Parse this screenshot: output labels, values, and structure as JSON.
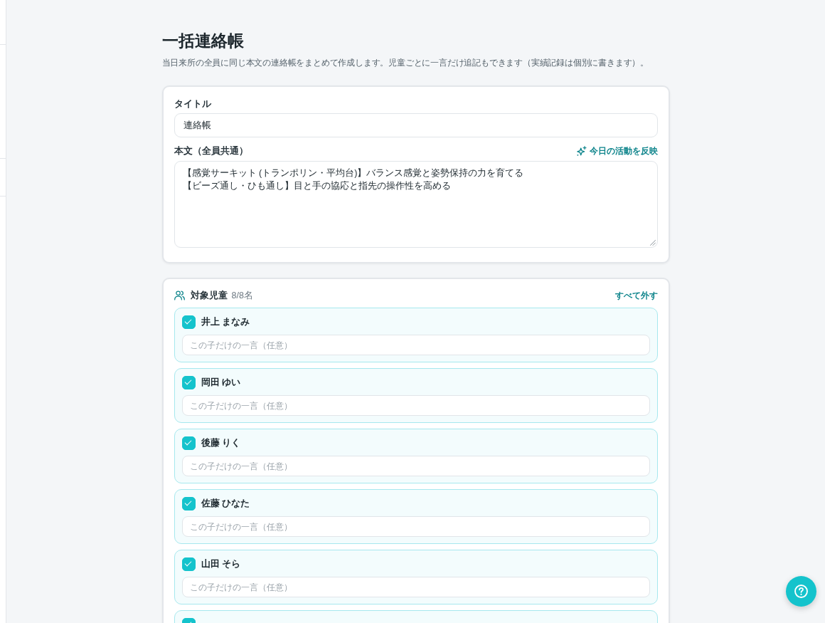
{
  "page": {
    "title": "一括連絡帳",
    "description": "当日来所の全員に同じ本文の連絡帳をまとめて作成します。児童ごとに一言だけ追記もできます（実績記録は個別に書きます）。"
  },
  "form": {
    "title_label": "タイトル",
    "title_value": "連絡帳",
    "body_label": "本文（全員共通）",
    "reflect_button": "今日の活動を反映",
    "body_lines": [
      "【感覚サーキット (トランポリン・平均台)】バランス感覚と姿勢保持の力を育てる",
      "【ビーズ通し・ひも通し】目と手の協応と指先の操作性を高める"
    ]
  },
  "targets": {
    "label": "対象児童",
    "count": "8/8名",
    "clear_button": "すべて外す",
    "children": [
      {
        "name": "井上 まなみ",
        "checked": true,
        "placeholder": "この子だけの一言（任意）"
      },
      {
        "name": "岡田 ゆい",
        "checked": true,
        "placeholder": "この子だけの一言（任意）"
      },
      {
        "name": "後藤 りく",
        "checked": true,
        "placeholder": "この子だけの一言（任意）"
      },
      {
        "name": "佐藤 ひなた",
        "checked": true,
        "placeholder": "この子だけの一言（任意）"
      },
      {
        "name": "山田 そら",
        "checked": true,
        "placeholder": "この子だけの一言（任意）"
      },
      {
        "checked": true
      }
    ]
  }
}
